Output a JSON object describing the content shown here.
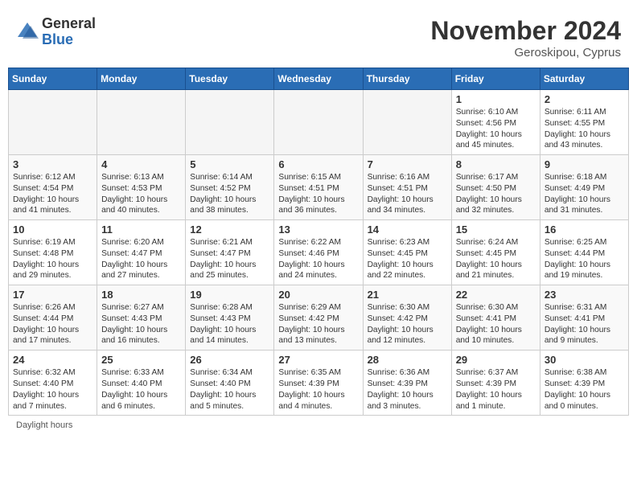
{
  "header": {
    "logo_general": "General",
    "logo_blue": "Blue",
    "month_year": "November 2024",
    "location": "Geroskipou, Cyprus"
  },
  "weekdays": [
    "Sunday",
    "Monday",
    "Tuesday",
    "Wednesday",
    "Thursday",
    "Friday",
    "Saturday"
  ],
  "weeks": [
    [
      {
        "day": "",
        "info": ""
      },
      {
        "day": "",
        "info": ""
      },
      {
        "day": "",
        "info": ""
      },
      {
        "day": "",
        "info": ""
      },
      {
        "day": "",
        "info": ""
      },
      {
        "day": "1",
        "info": "Sunrise: 6:10 AM\nSunset: 4:56 PM\nDaylight: 10 hours\nand 45 minutes."
      },
      {
        "day": "2",
        "info": "Sunrise: 6:11 AM\nSunset: 4:55 PM\nDaylight: 10 hours\nand 43 minutes."
      }
    ],
    [
      {
        "day": "3",
        "info": "Sunrise: 6:12 AM\nSunset: 4:54 PM\nDaylight: 10 hours\nand 41 minutes."
      },
      {
        "day": "4",
        "info": "Sunrise: 6:13 AM\nSunset: 4:53 PM\nDaylight: 10 hours\nand 40 minutes."
      },
      {
        "day": "5",
        "info": "Sunrise: 6:14 AM\nSunset: 4:52 PM\nDaylight: 10 hours\nand 38 minutes."
      },
      {
        "day": "6",
        "info": "Sunrise: 6:15 AM\nSunset: 4:51 PM\nDaylight: 10 hours\nand 36 minutes."
      },
      {
        "day": "7",
        "info": "Sunrise: 6:16 AM\nSunset: 4:51 PM\nDaylight: 10 hours\nand 34 minutes."
      },
      {
        "day": "8",
        "info": "Sunrise: 6:17 AM\nSunset: 4:50 PM\nDaylight: 10 hours\nand 32 minutes."
      },
      {
        "day": "9",
        "info": "Sunrise: 6:18 AM\nSunset: 4:49 PM\nDaylight: 10 hours\nand 31 minutes."
      }
    ],
    [
      {
        "day": "10",
        "info": "Sunrise: 6:19 AM\nSunset: 4:48 PM\nDaylight: 10 hours\nand 29 minutes."
      },
      {
        "day": "11",
        "info": "Sunrise: 6:20 AM\nSunset: 4:47 PM\nDaylight: 10 hours\nand 27 minutes."
      },
      {
        "day": "12",
        "info": "Sunrise: 6:21 AM\nSunset: 4:47 PM\nDaylight: 10 hours\nand 25 minutes."
      },
      {
        "day": "13",
        "info": "Sunrise: 6:22 AM\nSunset: 4:46 PM\nDaylight: 10 hours\nand 24 minutes."
      },
      {
        "day": "14",
        "info": "Sunrise: 6:23 AM\nSunset: 4:45 PM\nDaylight: 10 hours\nand 22 minutes."
      },
      {
        "day": "15",
        "info": "Sunrise: 6:24 AM\nSunset: 4:45 PM\nDaylight: 10 hours\nand 21 minutes."
      },
      {
        "day": "16",
        "info": "Sunrise: 6:25 AM\nSunset: 4:44 PM\nDaylight: 10 hours\nand 19 minutes."
      }
    ],
    [
      {
        "day": "17",
        "info": "Sunrise: 6:26 AM\nSunset: 4:44 PM\nDaylight: 10 hours\nand 17 minutes."
      },
      {
        "day": "18",
        "info": "Sunrise: 6:27 AM\nSunset: 4:43 PM\nDaylight: 10 hours\nand 16 minutes."
      },
      {
        "day": "19",
        "info": "Sunrise: 6:28 AM\nSunset: 4:43 PM\nDaylight: 10 hours\nand 14 minutes."
      },
      {
        "day": "20",
        "info": "Sunrise: 6:29 AM\nSunset: 4:42 PM\nDaylight: 10 hours\nand 13 minutes."
      },
      {
        "day": "21",
        "info": "Sunrise: 6:30 AM\nSunset: 4:42 PM\nDaylight: 10 hours\nand 12 minutes."
      },
      {
        "day": "22",
        "info": "Sunrise: 6:30 AM\nSunset: 4:41 PM\nDaylight: 10 hours\nand 10 minutes."
      },
      {
        "day": "23",
        "info": "Sunrise: 6:31 AM\nSunset: 4:41 PM\nDaylight: 10 hours\nand 9 minutes."
      }
    ],
    [
      {
        "day": "24",
        "info": "Sunrise: 6:32 AM\nSunset: 4:40 PM\nDaylight: 10 hours\nand 7 minutes."
      },
      {
        "day": "25",
        "info": "Sunrise: 6:33 AM\nSunset: 4:40 PM\nDaylight: 10 hours\nand 6 minutes."
      },
      {
        "day": "26",
        "info": "Sunrise: 6:34 AM\nSunset: 4:40 PM\nDaylight: 10 hours\nand 5 minutes."
      },
      {
        "day": "27",
        "info": "Sunrise: 6:35 AM\nSunset: 4:39 PM\nDaylight: 10 hours\nand 4 minutes."
      },
      {
        "day": "28",
        "info": "Sunrise: 6:36 AM\nSunset: 4:39 PM\nDaylight: 10 hours\nand 3 minutes."
      },
      {
        "day": "29",
        "info": "Sunrise: 6:37 AM\nSunset: 4:39 PM\nDaylight: 10 hours\nand 1 minute."
      },
      {
        "day": "30",
        "info": "Sunrise: 6:38 AM\nSunset: 4:39 PM\nDaylight: 10 hours\nand 0 minutes."
      }
    ]
  ],
  "footer": {
    "daylight_label": "Daylight hours"
  }
}
